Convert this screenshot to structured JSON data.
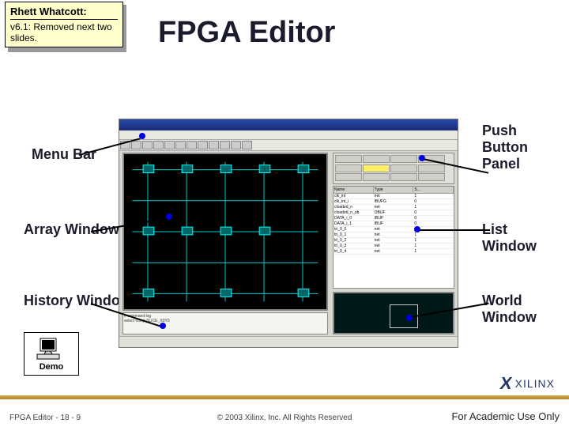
{
  "note": {
    "author": "Rhett Whatcott:",
    "body": "v6.1: Removed next two slides."
  },
  "title": "FPGA Editor",
  "labels": {
    "menu": "Menu Bar",
    "array": "Array Window",
    "history": "History Window",
    "push": "Push Button Panel",
    "list": "List Window",
    "world": "World Window"
  },
  "list_window": {
    "headers": [
      "Name",
      "Type",
      "S…"
    ],
    "rows": [
      [
        "clk_int",
        "net",
        "1"
      ],
      [
        "clk_int_i",
        "IBUFG",
        "0"
      ],
      [
        "cloaded_n",
        "net",
        "1"
      ],
      [
        "cloaded_n_ob",
        "OBUF",
        "0"
      ],
      [
        "DATA_i_0",
        "IBUF",
        "0"
      ],
      [
        "DATA_i_1",
        "IBUF",
        "0"
      ],
      [
        "tri_0_0",
        "net",
        "1"
      ],
      [
        "tri_0_1",
        "net",
        "1"
      ],
      [
        "tri_0_2",
        "net",
        "1"
      ],
      [
        "tri_0_3",
        "net",
        "1"
      ],
      [
        "tri_0_4",
        "net",
        "1"
      ]
    ]
  },
  "history": [
    "# command log",
    "select comp SLICE_X0Y0"
  ],
  "demo_label": "Demo",
  "footer": {
    "left": "FPGA Editor  -  18 - 9",
    "center": "© 2003 Xilinx, Inc. All Rights Reserved",
    "right": "For Academic Use Only",
    "logo": "XILINX"
  }
}
